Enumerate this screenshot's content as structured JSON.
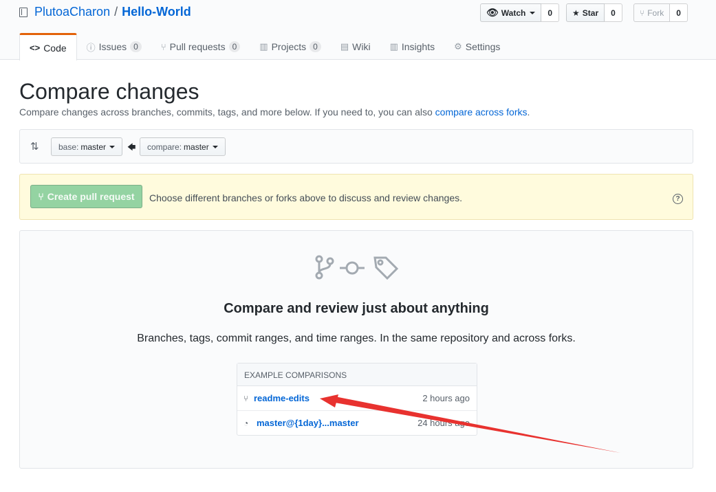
{
  "repo": {
    "owner": "PlutoaCharon",
    "separator": "/",
    "name": "Hello-World"
  },
  "actions": {
    "watch": {
      "label": "Watch",
      "count": "0"
    },
    "star": {
      "label": "Star",
      "count": "0"
    },
    "fork": {
      "label": "Fork",
      "count": "0"
    }
  },
  "tabs": [
    {
      "label": "Code",
      "icon": "code-icon",
      "glyph": "<>"
    },
    {
      "label": "Issues",
      "icon": "issue-icon",
      "glyph": "ⓘ",
      "count": "0"
    },
    {
      "label": "Pull requests",
      "icon": "pull-request-icon",
      "glyph": "⑂",
      "count": "0"
    },
    {
      "label": "Projects",
      "icon": "project-icon",
      "glyph": "▥",
      "count": "0"
    },
    {
      "label": "Wiki",
      "icon": "book-icon",
      "glyph": "▤"
    },
    {
      "label": "Insights",
      "icon": "graph-icon",
      "glyph": "▥"
    },
    {
      "label": "Settings",
      "icon": "gear-icon",
      "glyph": "⚙"
    }
  ],
  "page": {
    "title": "Compare changes",
    "subtitle_text": "Compare changes across branches, commits, tags, and more below. If you need to, you can also ",
    "subtitle_link": "compare across forks",
    "subtitle_end": "."
  },
  "range": {
    "base_label": "base:",
    "base_value": "master",
    "compare_label": "compare:",
    "compare_value": "master"
  },
  "flash": {
    "button_label": "Create pull request",
    "message": "Choose different branches or forks above to discuss and review changes.",
    "help_glyph": "?"
  },
  "blankslate": {
    "title": "Compare and review just about anything",
    "description": "Branches, tags, commit ranges, and time ranges. In the same repository and across forks."
  },
  "examples": {
    "header": "EXAMPLE COMPARISONS",
    "items": [
      {
        "label": "readme-edits",
        "time": "2 hours ago",
        "icon": "branch-icon"
      },
      {
        "label": "master@{1day}...master",
        "time": "24 hours ago",
        "icon": "clock-icon"
      }
    ]
  },
  "colors": {
    "link": "#0366d6",
    "tab_accent": "#e36209",
    "flash_bg": "#fffbdd",
    "cpr_button": "#94d3a2",
    "annotation_arrow": "#e8322f"
  }
}
